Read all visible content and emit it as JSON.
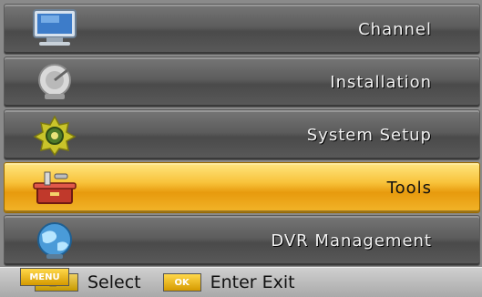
{
  "menu": {
    "items": [
      {
        "label": "Channel",
        "icon": "tv-icon"
      },
      {
        "label": "Installation",
        "icon": "satellite-dish-icon"
      },
      {
        "label": "System Setup",
        "icon": "gear-icon"
      },
      {
        "label": "Tools",
        "icon": "toolbox-icon",
        "selected": true
      },
      {
        "label": "DVR Management",
        "icon": "globe-icon"
      }
    ]
  },
  "help": {
    "select_key": "▲▼",
    "select_label": "Select",
    "enter_key": "OK",
    "enter_label": "Enter",
    "exit_key": "MENU",
    "exit_label": "Exit"
  },
  "colors": {
    "selected": "#f8c23a",
    "row": "#5c5c5c"
  }
}
